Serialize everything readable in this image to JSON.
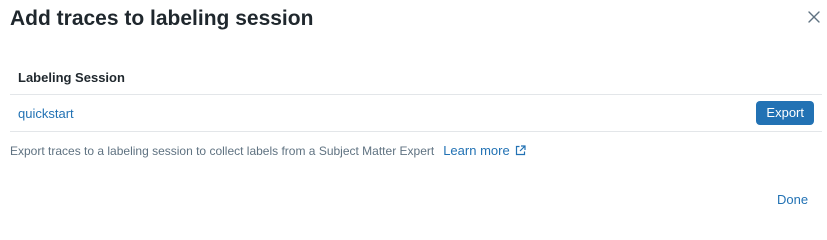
{
  "dialog": {
    "title": "Add traces to labeling session",
    "close_icon": "close-icon"
  },
  "table": {
    "columns": [
      "Labeling Session"
    ],
    "rows": [
      {
        "session_name": "quickstart",
        "action_label": "Export"
      }
    ]
  },
  "help": {
    "text": "Export traces to a labeling session to collect labels from a Subject Matter Expert",
    "link_label": "Learn more",
    "link_icon": "external-link-icon"
  },
  "footer": {
    "done_label": "Done"
  },
  "colors": {
    "primary": "#2272b4",
    "text": "#1f272d",
    "secondary_text": "#5f7281",
    "border": "#e3e6e9"
  }
}
